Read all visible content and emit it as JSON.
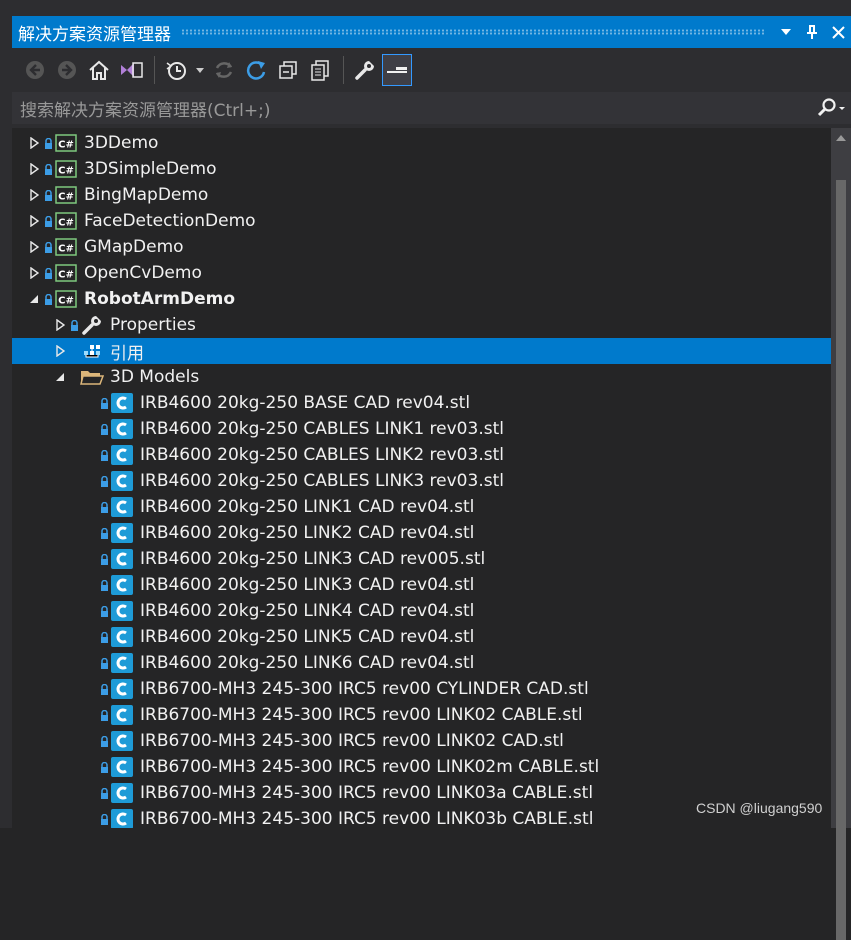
{
  "window": {
    "title": "解决方案资源管理器",
    "pin_glyph": "📌",
    "close_glyph": "✕"
  },
  "toolbar": {
    "buttons": [
      "back-icon",
      "forward-icon",
      "home-icon",
      "vs-switch-icon",
      "history-icon",
      "dropdown-icon",
      "sync-icon",
      "refresh-icon",
      "collapse-all-icon",
      "show-all-files-icon",
      "properties-wrench-icon",
      "preview-selected-icon"
    ]
  },
  "search": {
    "placeholder": "搜索解决方案资源管理器(Ctrl+;)"
  },
  "colors": {
    "accent": "#007acc",
    "csharp_green": "#7fc97f",
    "stl_blue": "#1e9bd7",
    "folder": "#dcb67a"
  },
  "tree": {
    "projects": [
      {
        "label": "3DDemo",
        "expanded": false
      },
      {
        "label": "3DSimpleDemo",
        "expanded": false
      },
      {
        "label": "BingMapDemo",
        "expanded": false
      },
      {
        "label": "FaceDetectionDemo",
        "expanded": false
      },
      {
        "label": "GMapDemo",
        "expanded": false
      },
      {
        "label": "OpenCvDemo",
        "expanded": false
      },
      {
        "label": "RobotArmDemo",
        "expanded": true
      }
    ],
    "children": [
      {
        "label": "Properties"
      },
      {
        "label": "引用"
      },
      {
        "label": "3D Models"
      }
    ],
    "files": [
      "IRB4600 20kg-250 BASE CAD rev04.stl",
      "IRB4600 20kg-250 CABLES LINK1 rev03.stl",
      "IRB4600 20kg-250 CABLES LINK2 rev03.stl",
      "IRB4600 20kg-250 CABLES LINK3 rev03.stl",
      "IRB4600 20kg-250 LINK1 CAD rev04.stl",
      "IRB4600 20kg-250 LINK2 CAD rev04.stl",
      "IRB4600 20kg-250 LINK3 CAD rev005.stl",
      "IRB4600 20kg-250 LINK3 CAD rev04.stl",
      "IRB4600 20kg-250 LINK4 CAD rev04.stl",
      "IRB4600 20kg-250 LINK5 CAD rev04.stl",
      "IRB4600 20kg-250 LINK6 CAD rev04.stl",
      "IRB6700-MH3 245-300 IRC5 rev00 CYLINDER CAD.stl",
      "IRB6700-MH3 245-300 IRC5 rev00 LINK02 CABLE.stl",
      "IRB6700-MH3 245-300 IRC5 rev00 LINK02 CAD.stl",
      "IRB6700-MH3 245-300 IRC5 rev00 LINK02m CABLE.stl",
      "IRB6700-MH3 245-300 IRC5 rev00 LINK03a CABLE.stl",
      "IRB6700-MH3 245-300 IRC5 rev00 LINK03b CABLE.stl"
    ]
  },
  "watermark": "CSDN @liugang590"
}
